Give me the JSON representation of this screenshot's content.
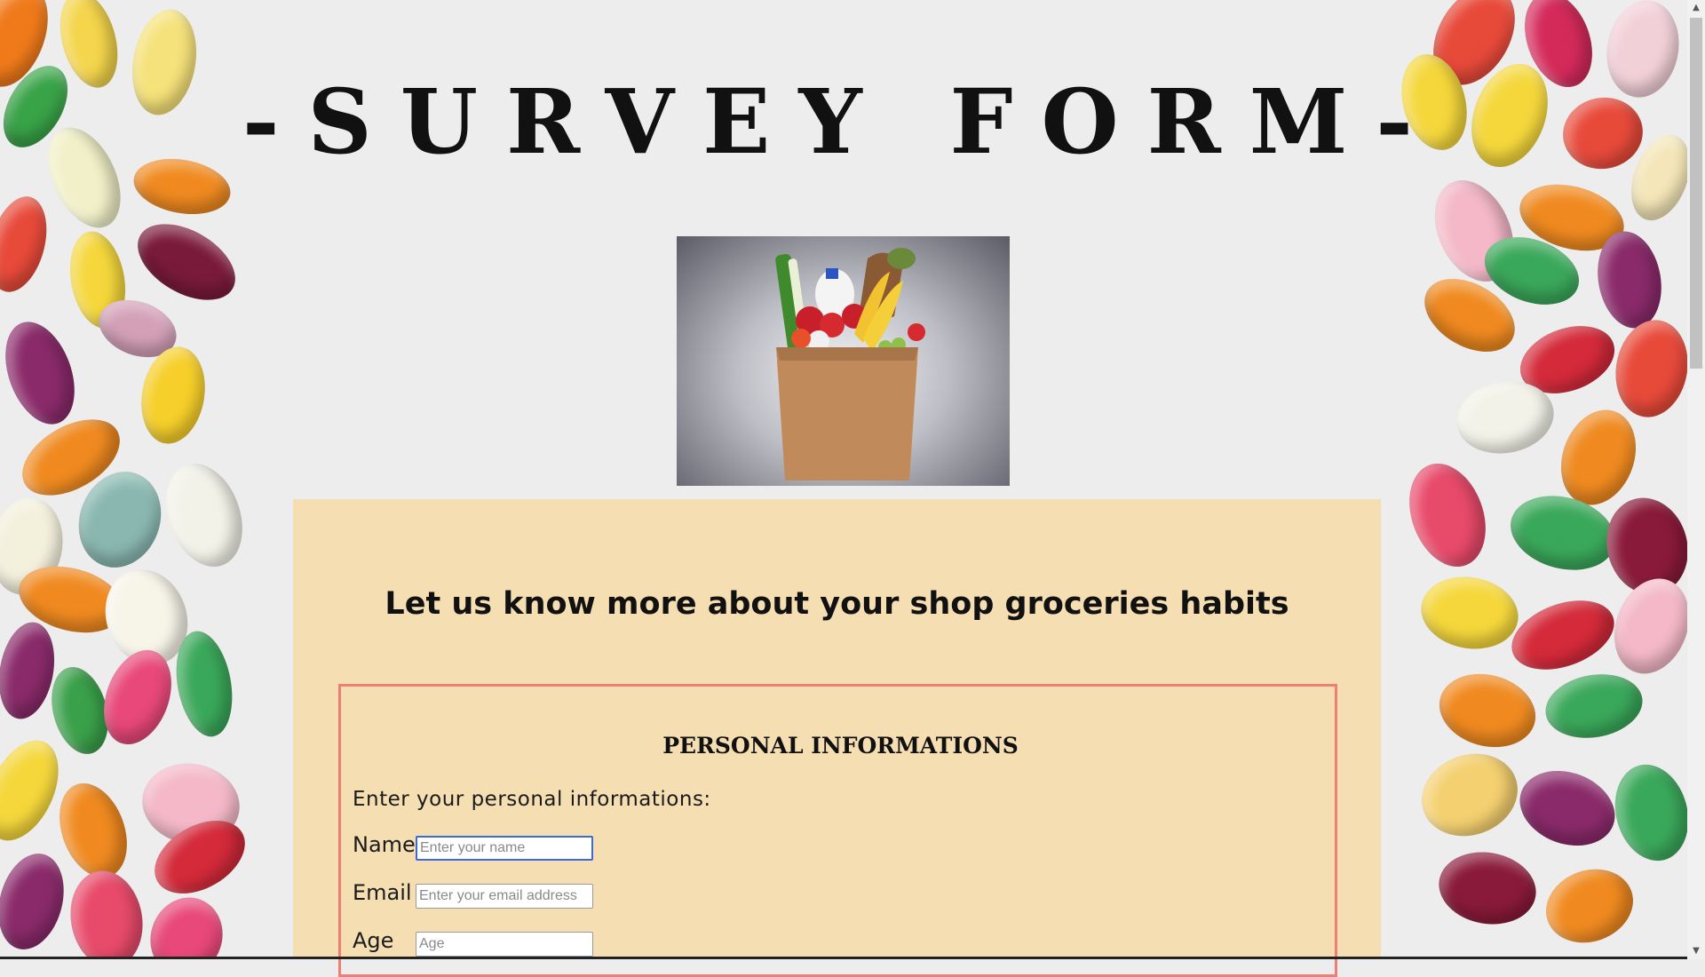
{
  "header": {
    "title": "-SURVEY FORM-"
  },
  "hero": {
    "icon": "grocery-bag-image"
  },
  "form": {
    "subtitle": "Let us know more about your shop groceries habits",
    "section": {
      "heading": "PERSONAL INFORMATIONS",
      "intro": "Enter your personal informations:",
      "fields": {
        "name": {
          "label": "Name",
          "placeholder": "Enter your name",
          "value": ""
        },
        "email": {
          "label": "Email",
          "placeholder": "Enter your email address",
          "value": ""
        },
        "age": {
          "label": "Age",
          "placeholder": "Age",
          "value": ""
        }
      }
    }
  },
  "colors": {
    "panel": "#f6deb3",
    "fieldset_border": "#ef7e74",
    "background": "#ededee"
  }
}
